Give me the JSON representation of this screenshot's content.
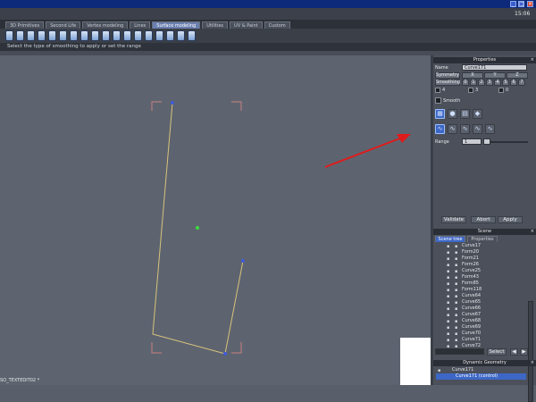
{
  "window": {
    "clock": "15:06",
    "minimize": "_",
    "maximize": "□",
    "close": "×"
  },
  "tabs": [
    "3D Primitives",
    "Second Life",
    "Vertex modeling",
    "Lines",
    "Surface modeling",
    "Utilities",
    "UV & Paint",
    "Custom"
  ],
  "active_tab": "Surface modeling",
  "hint": "Select the type of smoothing to apply or set the range",
  "status": "SO_TEXTEDIT02 *",
  "properties": {
    "title": "Properties",
    "name_label": "Name",
    "name_value": "Curve171",
    "symmetry_label": "Symmetry",
    "axes": [
      "X",
      "Y",
      "Z"
    ],
    "smoothing_label": "Smoothing",
    "smoothing_levels": [
      "0",
      "1",
      "2",
      "3",
      "4",
      "5",
      "6",
      "7"
    ],
    "counts": [
      "4",
      "3",
      "0"
    ],
    "smooth_label": "Smooth",
    "range_label": "Range",
    "range_value": "1",
    "validate": "Validate",
    "abort": "Abort",
    "apply": "Apply"
  },
  "scene": {
    "title": "Scene",
    "tabs": [
      "Scene tree",
      "Properties"
    ],
    "items": [
      "Curve17",
      "Form20",
      "Form21",
      "Form26",
      "Curve25",
      "Form43",
      "Form85",
      "Form118",
      "Curve64",
      "Curve65",
      "Curve66",
      "Curve67",
      "Curve68",
      "Curve69",
      "Curve70",
      "Curve71",
      "Curve72"
    ],
    "select_label": "Select"
  },
  "dynamic_geometry": {
    "title": "Dynamic Geometry",
    "items": [
      "Curve171",
      "Curve171 (control)"
    ]
  },
  "colors": {
    "accent": "#3d67c6",
    "curve": "#d8c27a",
    "arrow": "#e01b1b",
    "corner": "#c98080"
  }
}
